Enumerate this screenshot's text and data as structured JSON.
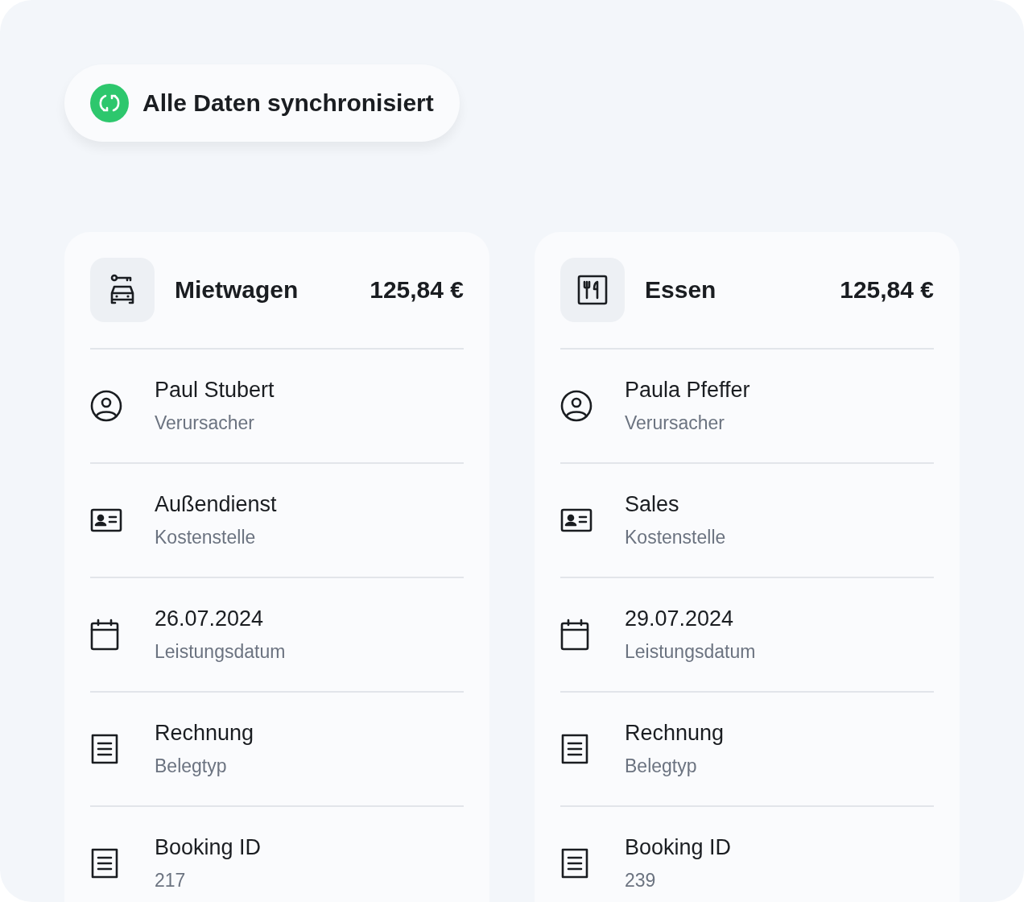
{
  "status": {
    "label": "Alle Daten synchronisiert"
  },
  "cards": [
    {
      "category": "Mietwagen",
      "kind": "car",
      "amount": "125,84 €",
      "rows": [
        {
          "kind": "person",
          "value": "Paul Stubert",
          "label": "Verursacher"
        },
        {
          "kind": "card",
          "value": "Außendienst",
          "label": "Kostenstelle"
        },
        {
          "kind": "date",
          "value": "26.07.2024",
          "label": "Leistungsdatum"
        },
        {
          "kind": "document",
          "value": "Rechnung",
          "label": "Belegtyp"
        },
        {
          "kind": "document",
          "value": "Booking ID",
          "label": "217"
        }
      ]
    },
    {
      "category": "Essen",
      "kind": "food",
      "amount": "125,84 €",
      "rows": [
        {
          "kind": "person",
          "value": "Paula Pfeffer",
          "label": "Verursacher"
        },
        {
          "kind": "card",
          "value": "Sales",
          "label": "Kostenstelle"
        },
        {
          "kind": "date",
          "value": "29.07.2024",
          "label": "Leistungsdatum"
        },
        {
          "kind": "document",
          "value": "Rechnung",
          "label": "Belegtyp"
        },
        {
          "kind": "document",
          "value": "Booking ID",
          "label": "239"
        }
      ]
    }
  ]
}
